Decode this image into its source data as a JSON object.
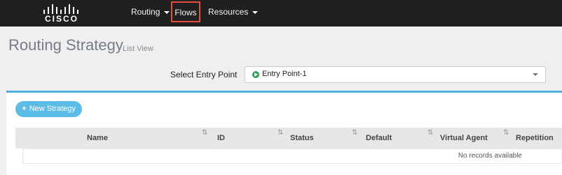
{
  "brand": {
    "name": "CISCO"
  },
  "nav": {
    "items": [
      {
        "label": "Routing",
        "has_dropdown": true
      },
      {
        "label": "Flows",
        "has_dropdown": false
      },
      {
        "label": "Resources",
        "has_dropdown": true
      }
    ]
  },
  "page": {
    "title": "Routing Strategy",
    "subtitle": "List View"
  },
  "entry_point": {
    "label": "Select Entry Point",
    "selected": "Entry Point-1",
    "icon": "play-circle-icon",
    "icon_color": "#2f9b5b"
  },
  "new_strategy": {
    "label": "New Strategy"
  },
  "table": {
    "columns": [
      "Name",
      "ID",
      "Status",
      "Default",
      "Virtual Agent",
      "Repetition"
    ],
    "empty_text": "No records available"
  },
  "colors": {
    "topbar": "#202020",
    "accent": "#4bb2df",
    "button": "#5bbce6",
    "highlight_border": "#e74c3c"
  }
}
